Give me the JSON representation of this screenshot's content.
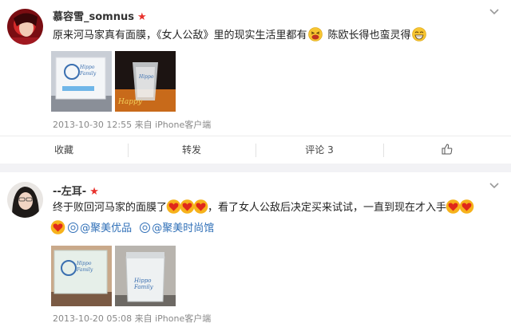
{
  "post1": {
    "username": "慕容雪_somnus",
    "text_a": "原来河马家真有面膜，《女人公敌》里的现实生活里都有",
    "text_b": "陈欧长得也蛮灵得",
    "timestamp": "2013-10-30 12:55 来自 iPhone客户端",
    "actions": {
      "collect": "收藏",
      "repost": "转发",
      "comment": "评论 3"
    },
    "images": [
      {
        "icon": "hippo-family-mask-box-photo",
        "label": "Hippo Family"
      },
      {
        "icon": "hippo-family-jar-photo",
        "label": "Hippo Family"
      }
    ]
  },
  "post2": {
    "username": "--左耳-",
    "text_a": "终于败回河马家的面膜了",
    "text_b": "，看了女人公敌后决定买来试试，一直到现在才入手",
    "mentions": [
      "@聚美优品",
      "@聚美时尚馆"
    ],
    "timestamp": "2013-10-20 05:08 来自 iPhone客户端",
    "images": [
      {
        "icon": "hippo-family-box-photo",
        "label": "Hippo Family"
      },
      {
        "icon": "hippo-family-jar-photo",
        "label": "Hippo Family"
      }
    ]
  },
  "colors": {
    "link": "#2f6fb7",
    "vip": "#e8322d",
    "separator": "#f2f2f5"
  },
  "icons": [
    "chevron-down-icon",
    "vip-star-icon",
    "laugh-emoji-icon",
    "grin-emoji-icon",
    "heart-emoji-icon",
    "like-thumb-icon",
    "mention-icon"
  ]
}
